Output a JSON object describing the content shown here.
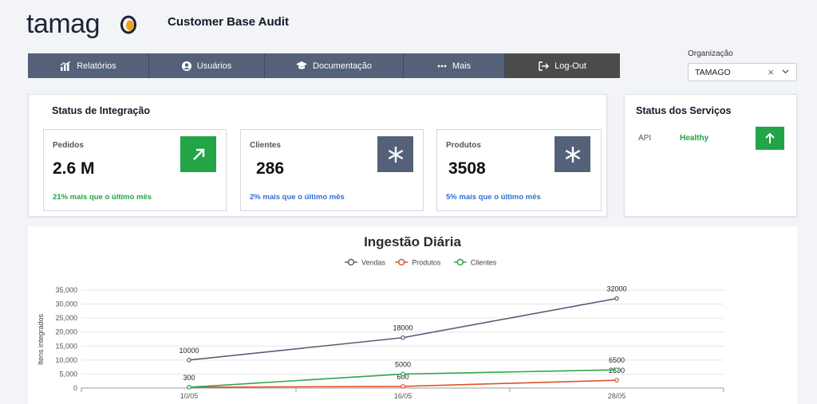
{
  "app": {
    "logo_text": "Tamago",
    "title": "Customer Base Audit"
  },
  "nav": {
    "items": [
      {
        "label": "Relatórios",
        "icon": "bar-chart-icon"
      },
      {
        "label": "Usuários",
        "icon": "user-icon"
      },
      {
        "label": "Documentação",
        "icon": "graduation-cap-icon"
      },
      {
        "label": "Mais",
        "icon": "more-dots-icon"
      },
      {
        "label": "Log-Out",
        "icon": "logout-icon"
      }
    ]
  },
  "organization": {
    "label": "Organização",
    "selected": "TAMAGO",
    "clear_symbol": "×"
  },
  "integration": {
    "title": "Status de Integração",
    "cards": [
      {
        "label": "Pedidos",
        "value": "2.6 M",
        "delta": "21% mais que o último mês",
        "delta_color": "#22a447",
        "icon": "arrow-up-right-icon",
        "icon_bg": "#22a447"
      },
      {
        "label": "Clientes",
        "value": "286",
        "delta": "2% mais que o último mês",
        "delta_color": "#2f6fdb",
        "icon": "asterisk-icon",
        "icon_bg": "#546178"
      },
      {
        "label": "Produtos",
        "value": "3508",
        "delta": "5% mais que o último mês",
        "delta_color": "#2f6fdb",
        "icon": "asterisk-icon",
        "icon_bg": "#546178"
      }
    ]
  },
  "services": {
    "title": "Status dos Serviços",
    "rows": [
      {
        "name": "API",
        "status": "Healthy",
        "status_color": "#22a447",
        "icon": "arrow-up-icon"
      }
    ]
  },
  "chart_data": {
    "type": "line",
    "title": "Ingestão Diária",
    "ylabel": "Itens integrados",
    "xlabel": "",
    "categories": [
      "10/05",
      "16/05",
      "28/05"
    ],
    "ylim": [
      0,
      35000
    ],
    "yticks": [
      0,
      5000,
      10000,
      15000,
      20000,
      25000,
      30000,
      35000
    ],
    "ytick_labels": [
      "0",
      "5,000",
      "10,000",
      "15,000",
      "20,000",
      "25,000",
      "30,000",
      "35,000"
    ],
    "grid": true,
    "legend": "top-center",
    "series": [
      {
        "name": "Vendas",
        "values": [
          10000,
          18000,
          32000
        ],
        "color": "#546178",
        "labels": [
          "10000",
          "18000",
          "32000"
        ]
      },
      {
        "name": "Produtos",
        "values": [
          300,
          600,
          2800
        ],
        "color": "#e0532a",
        "labels": [
          "300",
          "600",
          "2800"
        ]
      },
      {
        "name": "Clientes",
        "values": [
          300,
          5000,
          6500
        ],
        "color": "#2ea44f",
        "labels": [
          "",
          "5000",
          "6500"
        ]
      }
    ]
  }
}
